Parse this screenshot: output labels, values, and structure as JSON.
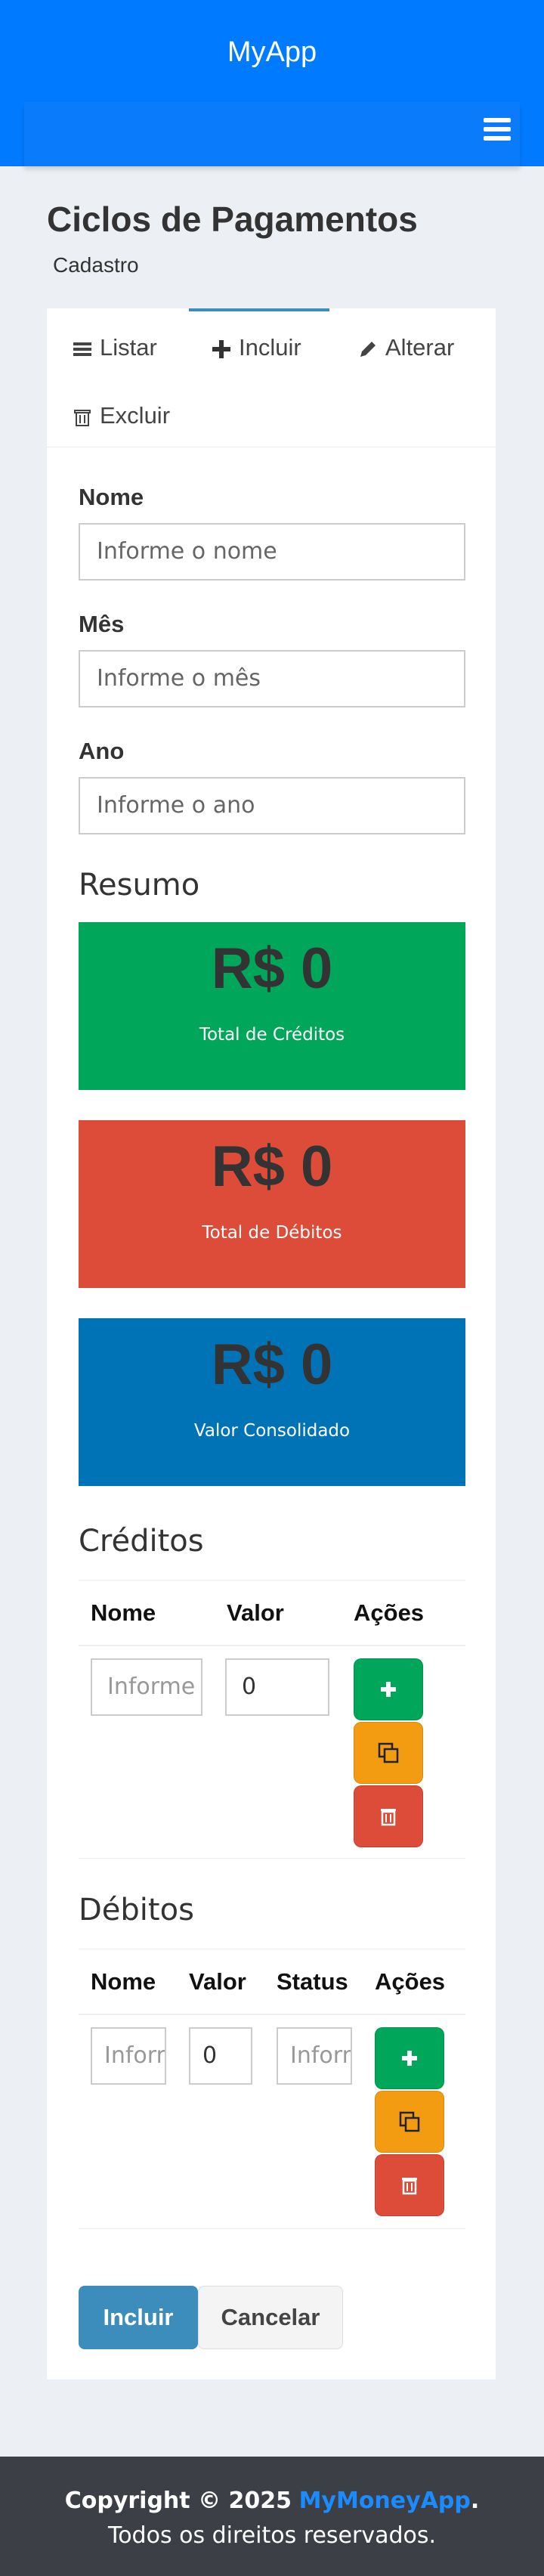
{
  "app": {
    "title": "MyApp"
  },
  "page": {
    "title": "Ciclos de Pagamentos",
    "subtitle": "Cadastro"
  },
  "tabs": [
    {
      "label": "Listar",
      "icon": "bars-icon"
    },
    {
      "label": "Incluir",
      "icon": "plus-icon",
      "active": true
    },
    {
      "label": "Alterar",
      "icon": "pencil-icon"
    },
    {
      "label": "Excluir",
      "icon": "trash-icon"
    }
  ],
  "form": {
    "name_label": "Nome",
    "name_placeholder": "Informe o nome",
    "month_label": "Mês",
    "month_placeholder": "Informe o mês",
    "year_label": "Ano",
    "year_placeholder": "Informe o ano"
  },
  "summary": {
    "title": "Resumo",
    "credits": {
      "value": "R$ 0",
      "label": "Total de Créditos",
      "color": "#00a65a"
    },
    "debits": {
      "value": "R$ 0",
      "label": "Total de Débitos",
      "color": "#dd4b39"
    },
    "consolidated": {
      "value": "R$ 0",
      "label": "Valor Consolidado",
      "color": "#0073b7"
    }
  },
  "credits": {
    "title": "Créditos",
    "headers": {
      "name": "Nome",
      "value": "Valor",
      "actions": "Ações"
    },
    "row": {
      "name_placeholder": "Informe o nome",
      "value": "0"
    }
  },
  "debits": {
    "title": "Débitos",
    "headers": {
      "name": "Nome",
      "value": "Valor",
      "status": "Status",
      "actions": "Ações"
    },
    "row": {
      "name_placeholder": "Informe o nome",
      "value": "0",
      "status_placeholder": "Informe o status"
    }
  },
  "buttons": {
    "submit": "Incluir",
    "cancel": "Cancelar"
  },
  "footer": {
    "copyright": "Copyright © 2025",
    "brand": "MyMoneyApp",
    "suffix": "Todos os direitos reservados."
  },
  "colors": {
    "header": "#007bff",
    "add_button": "#00a65a",
    "clone_button": "#f39c12",
    "delete_button": "#dd4b39"
  }
}
